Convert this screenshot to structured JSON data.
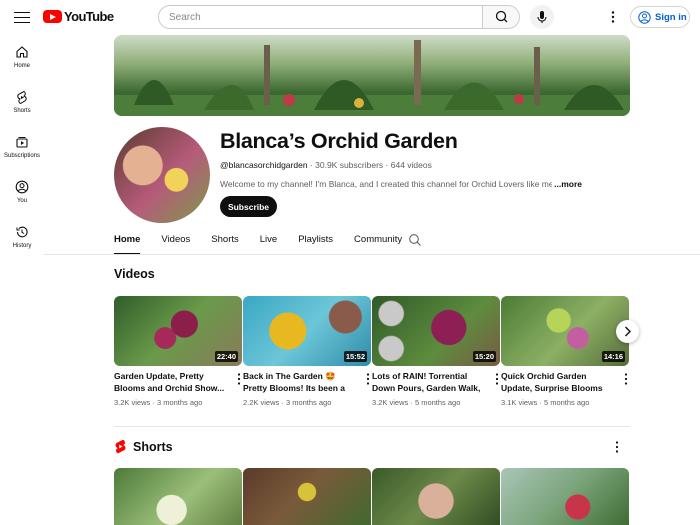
{
  "header": {
    "logo_text": "YouTube",
    "search_placeholder": "Search",
    "sign_in_label": "Sign in"
  },
  "sidebar": {
    "items": [
      {
        "label": "Home",
        "icon": "home-icon"
      },
      {
        "label": "Shorts",
        "icon": "shorts-icon"
      },
      {
        "label": "Subscriptions",
        "icon": "subscriptions-icon"
      },
      {
        "label": "You",
        "icon": "you-icon"
      },
      {
        "label": "History",
        "icon": "history-icon"
      }
    ]
  },
  "channel": {
    "name": "Blanca’s Orchid Garden",
    "handle": "@blancasorchidgarden",
    "subscribers": "30.9K subscribers",
    "videos_count": "644 videos",
    "description": "Welcome to my channel! I'm Blanca, and I created this channel for Orchid Lovers like me",
    "more_label": "...more",
    "subscribe_label": "Subscribe"
  },
  "tabs": [
    {
      "label": "Home",
      "active": true
    },
    {
      "label": "Videos",
      "active": false
    },
    {
      "label": "Shorts",
      "active": false
    },
    {
      "label": "Live",
      "active": false
    },
    {
      "label": "Playlists",
      "active": false
    },
    {
      "label": "Community",
      "active": false
    }
  ],
  "videos_section": {
    "title": "Videos",
    "items": [
      {
        "title": "Garden Update, Pretty Blooms and Orchid Show...",
        "views": "3.2K views",
        "age": "3 months ago",
        "duration": "22:40"
      },
      {
        "title": "Back in The Garden 🤩 Pretty Blooms! Its been a while,...",
        "views": "2.2K views",
        "age": "3 months ago",
        "duration": "15:52"
      },
      {
        "title": "Lots of RAIN! Torrential Down Pours, Garden Walk, Pretty...",
        "views": "3.2K views",
        "age": "5 months ago",
        "duration": "15:20"
      },
      {
        "title": "Quick Orchid Garden Update, Surprise Blooms and Morni...",
        "views": "3.1K views",
        "age": "5 months ago",
        "duration": "14:16"
      }
    ]
  },
  "shorts_section": {
    "title": "Shorts"
  },
  "colors": {
    "brand_red": "#ff0000",
    "link_blue": "#065fd4",
    "text": "#0f0f0f",
    "secondary_text": "#606060"
  }
}
